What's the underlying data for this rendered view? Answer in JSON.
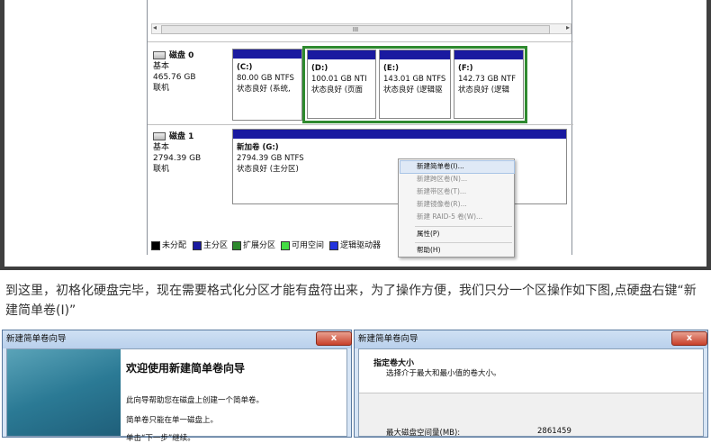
{
  "disk_mgmt": {
    "scroll_thumb": "III",
    "disk0": {
      "name": "磁盘 0",
      "type": "基本",
      "size": "465.76 GB",
      "status": "联机"
    },
    "disk1": {
      "name": "磁盘 1",
      "type": "基本",
      "size": "2794.39 GB",
      "status": "联机"
    },
    "partitions": {
      "c": {
        "name": "(C:)",
        "size": "80.00 GB NTFS",
        "status": "状态良好 (系统,"
      },
      "d": {
        "name": "(D:)",
        "size": "100.01 GB NTI",
        "status": "状态良好 (页面"
      },
      "e": {
        "name": "(E:)",
        "size": "143.01 GB NTFS",
        "status": "状态良好 (逻辑驱"
      },
      "f": {
        "name": "(F:)",
        "size": "142.73 GB NTF",
        "status": "状态良好 (逻辑"
      },
      "g": {
        "name": "新加卷  (G:)",
        "size": "2794.39 GB NTFS",
        "status": "状态良好 (主分区)"
      }
    },
    "legend": [
      {
        "label": "未分配",
        "color": "#000000"
      },
      {
        "label": "主分区",
        "color": "#1a1aa0"
      },
      {
        "label": "扩展分区",
        "color": "#2f8a2f"
      },
      {
        "label": "可用空间",
        "color": "#44dd44"
      },
      {
        "label": "逻辑驱动器",
        "color": "#2233dd"
      }
    ],
    "context_menu": {
      "new_simple": "新建简单卷(I)...",
      "new_spanned": "新建跨区卷(N)...",
      "new_striped": "新建带区卷(T)...",
      "new_mirrored": "新建镜像卷(R)...",
      "new_raid5": "新建 RAID-5 卷(W)...",
      "properties": "属性(P)",
      "help": "帮助(H)"
    }
  },
  "caption": "到这里，初格化硬盘完毕，现在需要格式化分区才能有盘符出来，为了操作方便，我们只分一个区操作如下图,点硬盘右键“新建简单卷(I)”",
  "wizard1": {
    "title": "新建简单卷向导",
    "close": "x",
    "heading": "欢迎使用新建简单卷向导",
    "line1": "此向导帮助您在磁盘上创建一个简单卷。",
    "line2": "简单卷只能在单一磁盘上。",
    "line3": "单击“下一步”继续。"
  },
  "wizard2": {
    "title": "新建简单卷向导",
    "close": "x",
    "heading": "指定卷大小",
    "subheading": "选择介于最大和最小值的卷大小。",
    "max_label": "最大磁盘空间量(MB):",
    "max_value": "2861459"
  }
}
